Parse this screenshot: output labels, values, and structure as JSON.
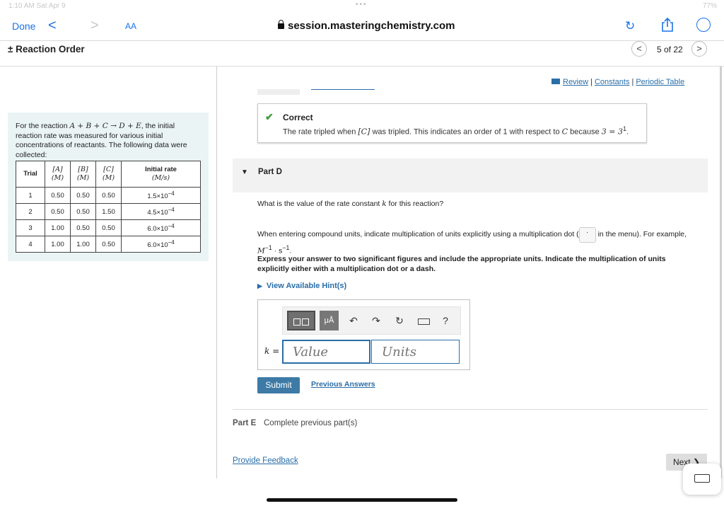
{
  "status": {
    "time": "1:10 AM  Sat Apr 9",
    "battery": "77%"
  },
  "browser": {
    "done": "Done",
    "back": "<",
    "forward": ">",
    "text_size": "AA",
    "url": "session.masteringchemistry.com"
  },
  "header": {
    "title": "± Reaction Order",
    "prev": "<",
    "next": ">",
    "pager": "5 of 22"
  },
  "problem": {
    "text_pre": "For the reaction ",
    "reaction": "A + B + C → D + E",
    "text_post": ", the initial reaction rate was measured for various initial concentrations of reactants. The following data were collected:",
    "columns": [
      {
        "top": "Trial",
        "bottom": ""
      },
      {
        "top": "[A]",
        "bottom": "(M)"
      },
      {
        "top": "[B]",
        "bottom": "(M)"
      },
      {
        "top": "[C]",
        "bottom": "(M)"
      },
      {
        "top": "Initial rate",
        "bottom": "(M/s)"
      }
    ],
    "rows": [
      {
        "trial": "1",
        "a": "0.50",
        "b": "0.50",
        "c": "0.50",
        "rate_base": "1.5×10",
        "rate_exp": "−4"
      },
      {
        "trial": "2",
        "a": "0.50",
        "b": "0.50",
        "c": "1.50",
        "rate_base": "4.5×10",
        "rate_exp": "−4"
      },
      {
        "trial": "3",
        "a": "1.00",
        "b": "0.50",
        "c": "0.50",
        "rate_base": "6.0×10",
        "rate_exp": "−4"
      },
      {
        "trial": "4",
        "a": "1.00",
        "b": "1.00",
        "c": "0.50",
        "rate_base": "6.0×10",
        "rate_exp": "−4"
      }
    ]
  },
  "links": {
    "review": "Review",
    "constants": "Constants",
    "periodic": "Periodic Table",
    "sep": "|"
  },
  "correct": {
    "label": "Correct",
    "msg_a": "The rate tripled when ",
    "msg_c": "[C]",
    "msg_b": " was tripled. This indicates an order of 1 with respect to ",
    "msg_var": "C",
    "msg_d": " because ",
    "msg_eq": "3 = 3",
    "msg_exp": "1",
    "msg_end": "."
  },
  "part_d": {
    "label": "Part D",
    "question_a": "What is the value of the rate constant ",
    "question_var": "k",
    "question_b": " for this reaction?",
    "units_note_a": "When entering compound units, indicate multiplication of units explicitly using a multiplication dot (",
    "units_note_dot": "·",
    "units_note_b": " in the menu). For example, ",
    "units_note_ex": "M",
    "units_note_sup1": "−1",
    "units_note_mid": " · s",
    "units_note_sup2": "−1",
    "units_note_end": ".",
    "instructions": "Express your answer to two significant figures and include the appropriate units. Indicate the multiplication of units explicitly either with a multiplication dot or a dash.",
    "hints": "View Available Hint(s)",
    "tools": {
      "units": "μÅ",
      "undo": "↶",
      "redo": "↷",
      "reset": "↻",
      "help": "?"
    },
    "k_label": "k =",
    "value_placeholder": "Value",
    "units_placeholder": "Units",
    "submit": "Submit",
    "previous_answers": "Previous Answers"
  },
  "part_e": {
    "label": "Part E",
    "text": "Complete previous part(s)"
  },
  "footer": {
    "feedback": "Provide Feedback",
    "next": "Next ❯"
  }
}
